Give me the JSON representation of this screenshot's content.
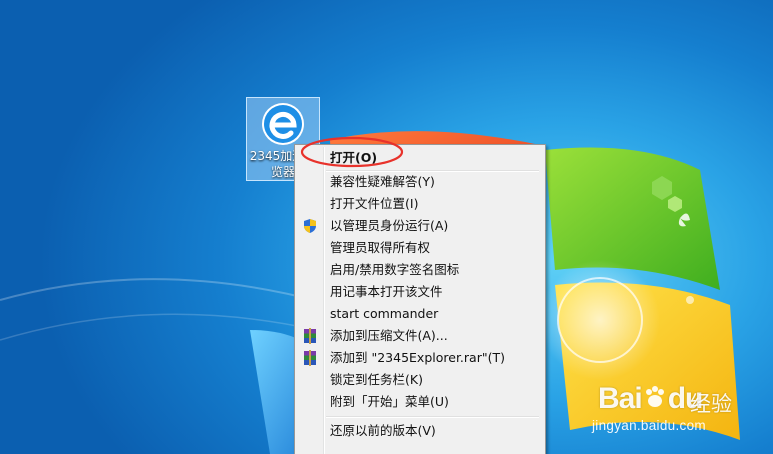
{
  "desktop": {
    "shortcut": {
      "label": "2345加速浏览器",
      "icon": "ie-style-e-icon"
    }
  },
  "context_menu": {
    "items": [
      {
        "label": "打开(O)",
        "bold": true,
        "icon": null
      },
      {
        "label": "兼容性疑难解答(Y)",
        "icon": null
      },
      {
        "label": "打开文件位置(I)",
        "icon": null
      },
      {
        "label": "以管理员身份运行(A)",
        "icon": "uac-shield-icon"
      },
      {
        "label": "管理员取得所有权",
        "icon": null
      },
      {
        "label": "启用/禁用数字签名图标",
        "icon": null
      },
      {
        "label": "用记事本打开该文件",
        "icon": null
      },
      {
        "label": "start commander",
        "icon": null
      },
      {
        "label": "添加到压缩文件(A)...",
        "icon": "winrar-icon"
      },
      {
        "label": "添加到 \"2345Explorer.rar\"(T)",
        "icon": "winrar-icon"
      },
      {
        "label": "锁定到任务栏(K)",
        "icon": null
      },
      {
        "label": "附到「开始」菜单(U)",
        "icon": null
      },
      {
        "label": "还原以前的版本(V)",
        "icon": null
      }
    ]
  },
  "annotation": {
    "color": "#e8322b"
  },
  "watermark": {
    "brand": "Bai",
    "brand_end": "du",
    "sub": "经验",
    "url": "jingyan.baidu.com"
  },
  "colors": {
    "desktop_blue": "#1a86d4",
    "menu_bg": "#f0f0f0",
    "highlight": "#e8322b"
  }
}
